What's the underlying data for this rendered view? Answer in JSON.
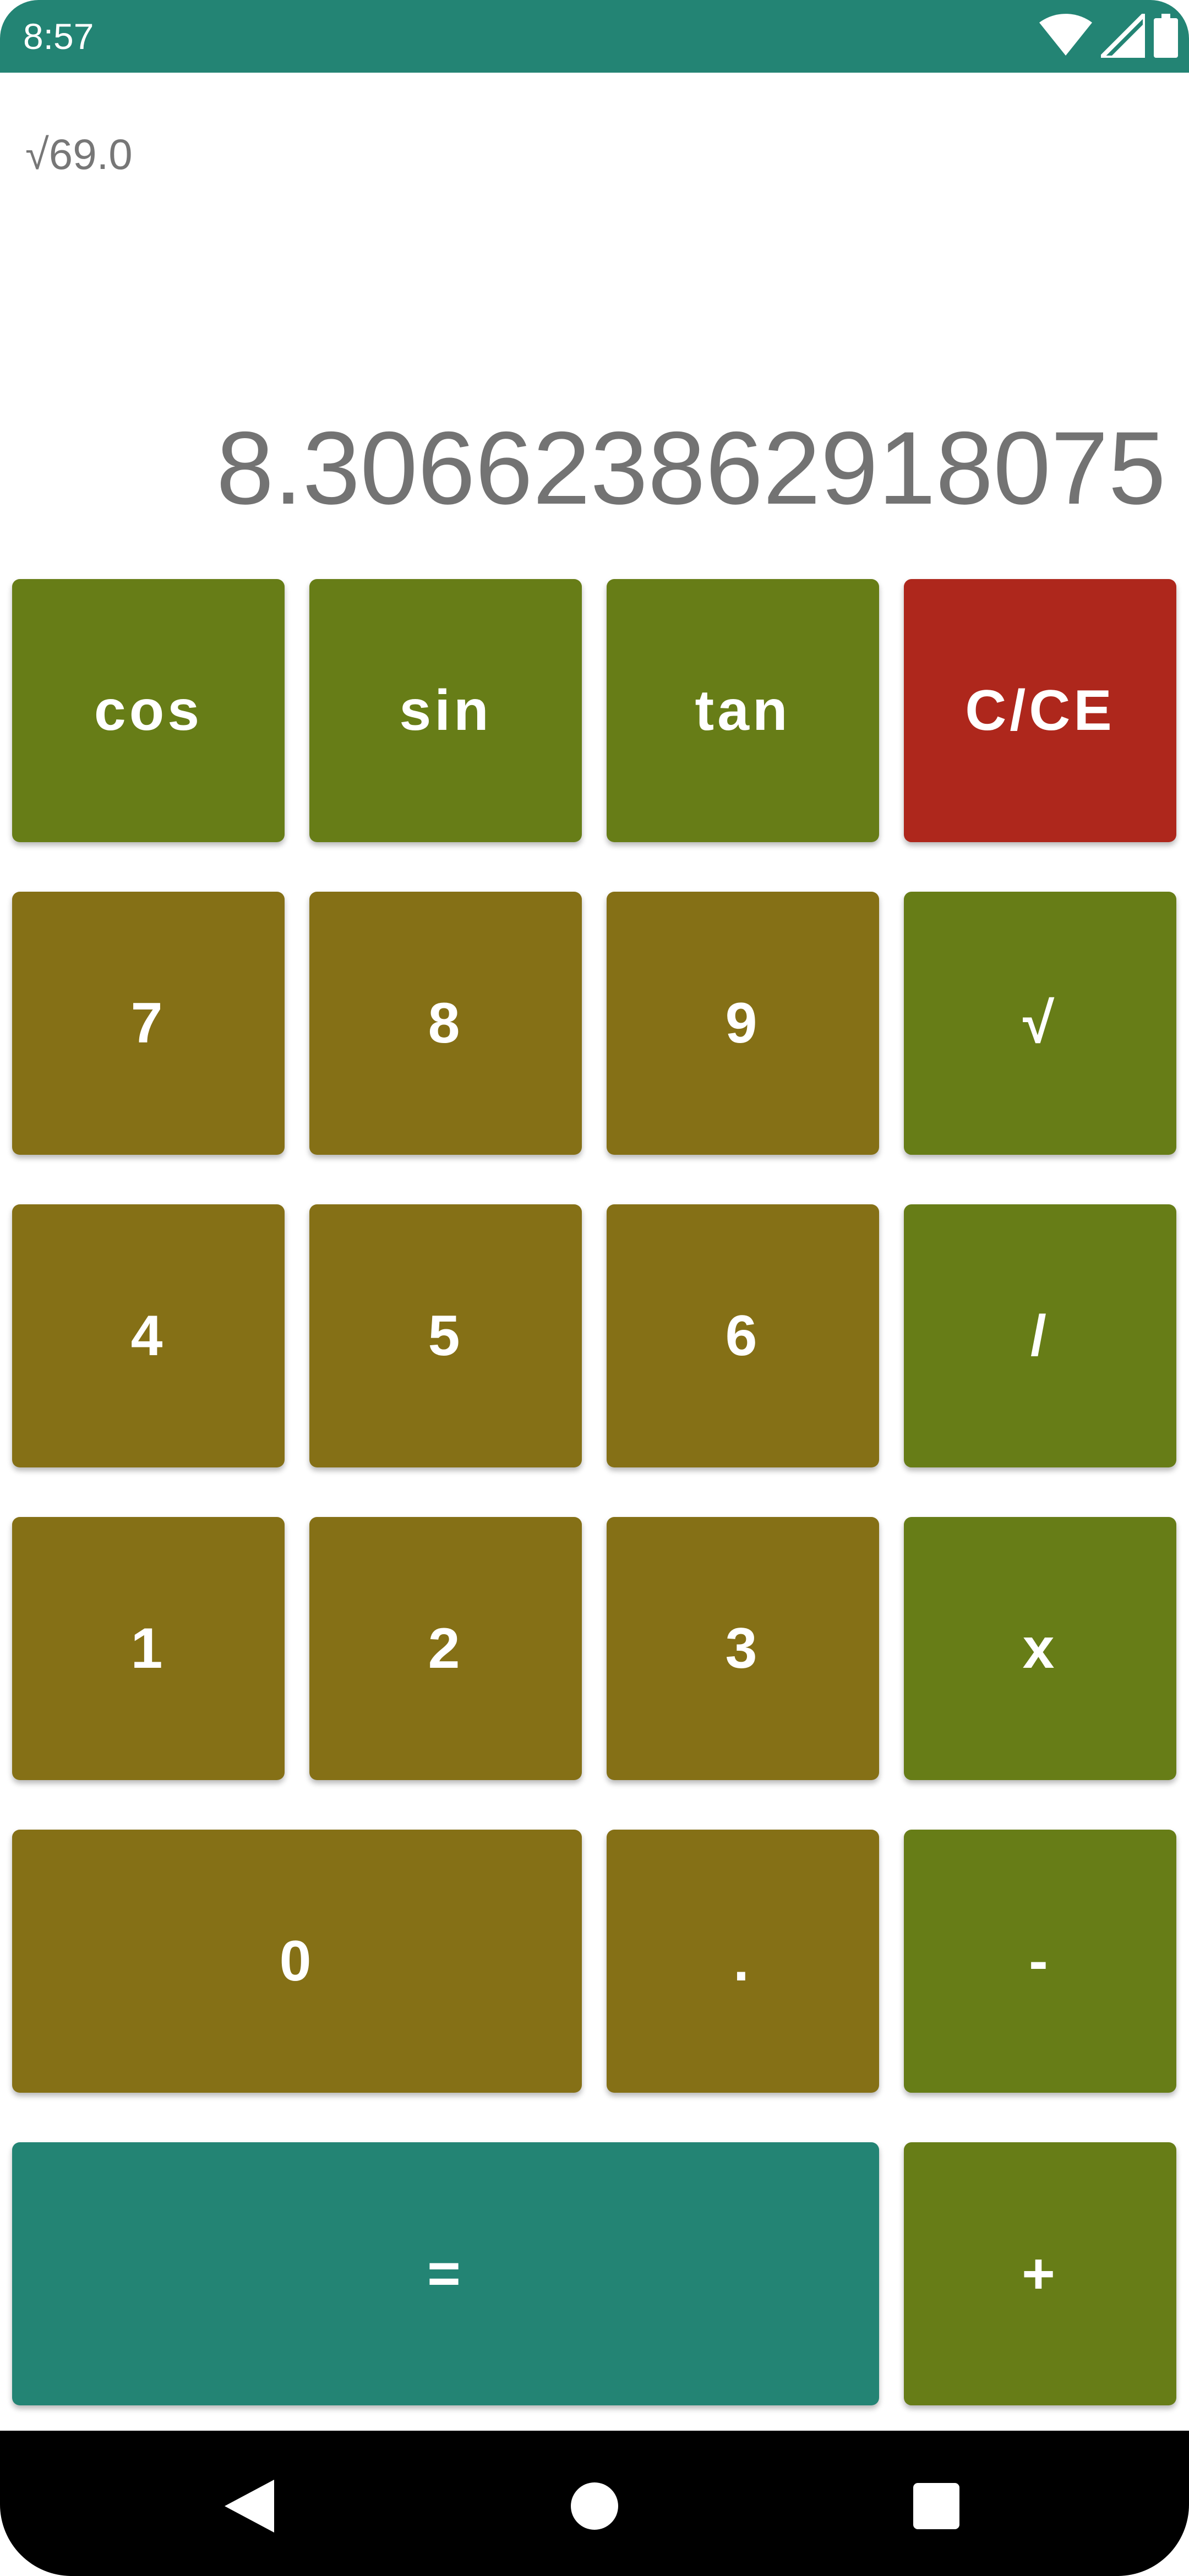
{
  "status_bar": {
    "time": "8:57",
    "icons": [
      "wifi-icon",
      "cellular-signal-icon",
      "battery-icon"
    ],
    "background_color": "#238474"
  },
  "display": {
    "expression": "√69.0",
    "result": "8.306623862918075"
  },
  "keypad": {
    "cos": "cos",
    "sin": "sin",
    "tan": "tan",
    "clear": "C/CE",
    "seven": "7",
    "eight": "8",
    "nine": "9",
    "sqrt": "√",
    "four": "4",
    "five": "5",
    "six": "6",
    "divide": "/",
    "one": "1",
    "two": "2",
    "three": "3",
    "multiply": "x",
    "zero": "0",
    "decimal": ".",
    "subtract": "-",
    "equals": "=",
    "add": "+"
  },
  "colors": {
    "function_key": "#677d17",
    "number_key": "#857016",
    "clear_key": "#ae271c",
    "equals_key": "#238474"
  },
  "nav_bar": {
    "icons": [
      "back-icon",
      "home-icon",
      "recents-icon"
    ]
  }
}
